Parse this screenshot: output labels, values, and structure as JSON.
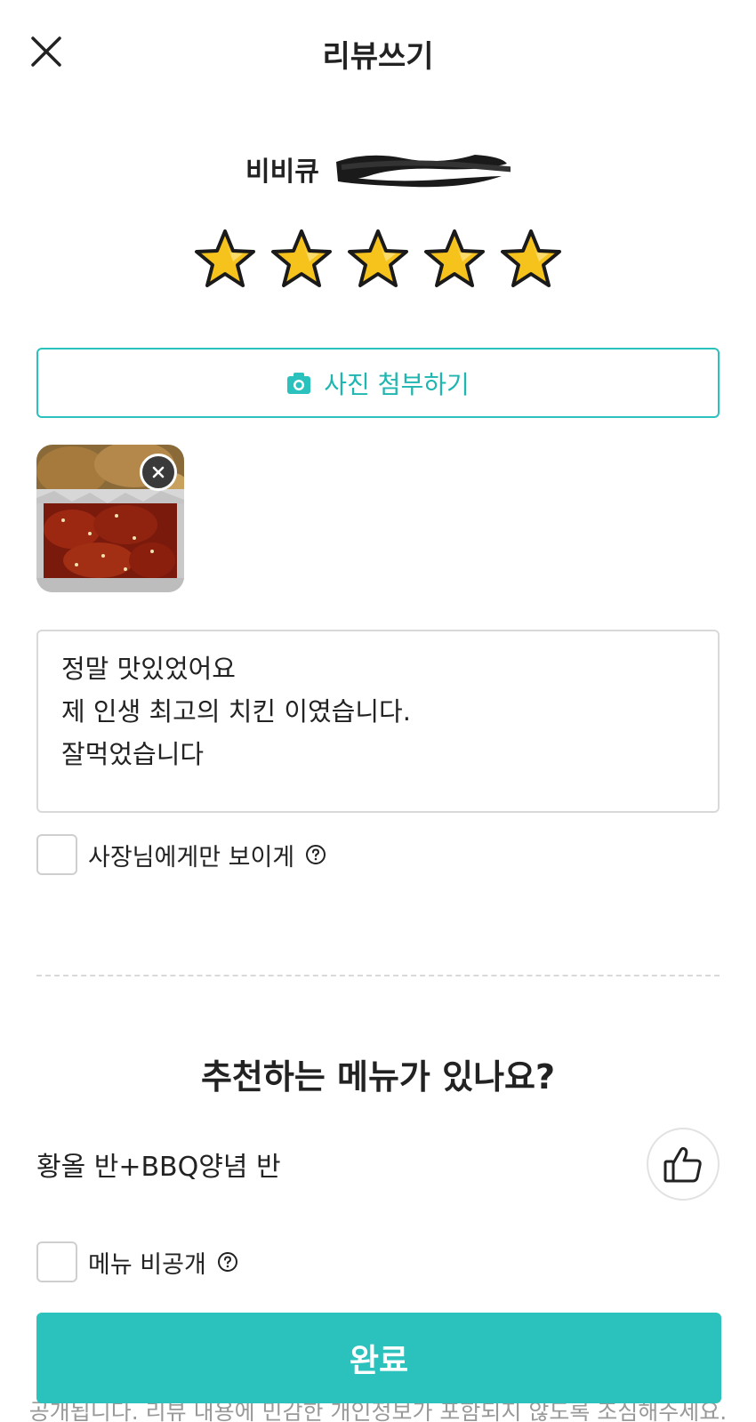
{
  "header": {
    "title": "리뷰쓰기",
    "close_icon": "close-icon"
  },
  "store": {
    "name": "비비큐"
  },
  "rating": {
    "value": 5,
    "max": 5,
    "star_color": "#f6c21c"
  },
  "photo_button": {
    "label": "사진 첨부하기",
    "icon": "camera-icon",
    "accent": "#2bc1bc"
  },
  "attachment": {
    "remove_icon": "close-circle-icon"
  },
  "review": {
    "lines": [
      "정말 맛있었어요",
      "제 인생 최고의 치킨 이였습니다.",
      "잘먹었습니다"
    ]
  },
  "owner_only": {
    "label": "사장님에게만 보이게",
    "checked": false
  },
  "recommend": {
    "title": "추천하는 메뉴가 있나요?",
    "items": [
      {
        "name": "황올 반+BBQ양념 반",
        "liked": false
      }
    ]
  },
  "menu_private": {
    "label": "메뉴 비공개",
    "checked": false
  },
  "notice": "공개됩니다. 리뷰 내용에 민감한 개인정보가 포함되지 않도록 조심해주세요.",
  "submit": {
    "label": "완료",
    "color": "#2bc1bc"
  }
}
